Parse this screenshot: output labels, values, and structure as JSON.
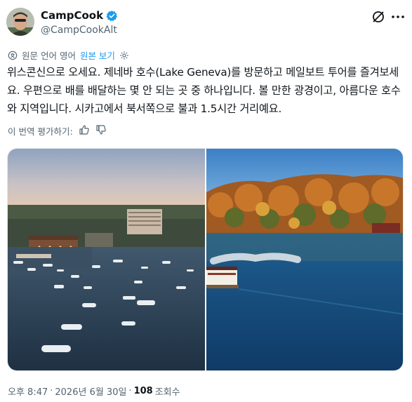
{
  "author": {
    "display_name": "CampCook",
    "handle": "@CampCookAlt",
    "verified": true,
    "avatar_icon": "avatar-photo"
  },
  "translation": {
    "notice": "원문 언어 영어",
    "show_original": "원본 보기"
  },
  "tweet": {
    "text": "위스콘신으로 오세요. 제네바 호수(Lake Geneva)를 방문하고 메일보트 투어를 즐겨보세요. 우편으로 배를 배달하는 몇 안 되는 곳 중 하나입니다. 볼 만한 광경이고, 아름다운 호수와 지역입니다. 시카고에서 북서쪽으로 불과 1.5시간 거리예요."
  },
  "rate_translation": {
    "label": "이 번역 평가하기:"
  },
  "media": {
    "left_image": "lake-town-dusk-boats",
    "right_image": "autumn-shore-steamboat"
  },
  "meta": {
    "time": "오후 8:47",
    "date": "2026년 6월 30일",
    "separator": "·",
    "views": "108",
    "views_label": "조회수"
  },
  "colors": {
    "accent": "#1d9bf0",
    "text": "#0f1419",
    "muted": "#536471"
  }
}
